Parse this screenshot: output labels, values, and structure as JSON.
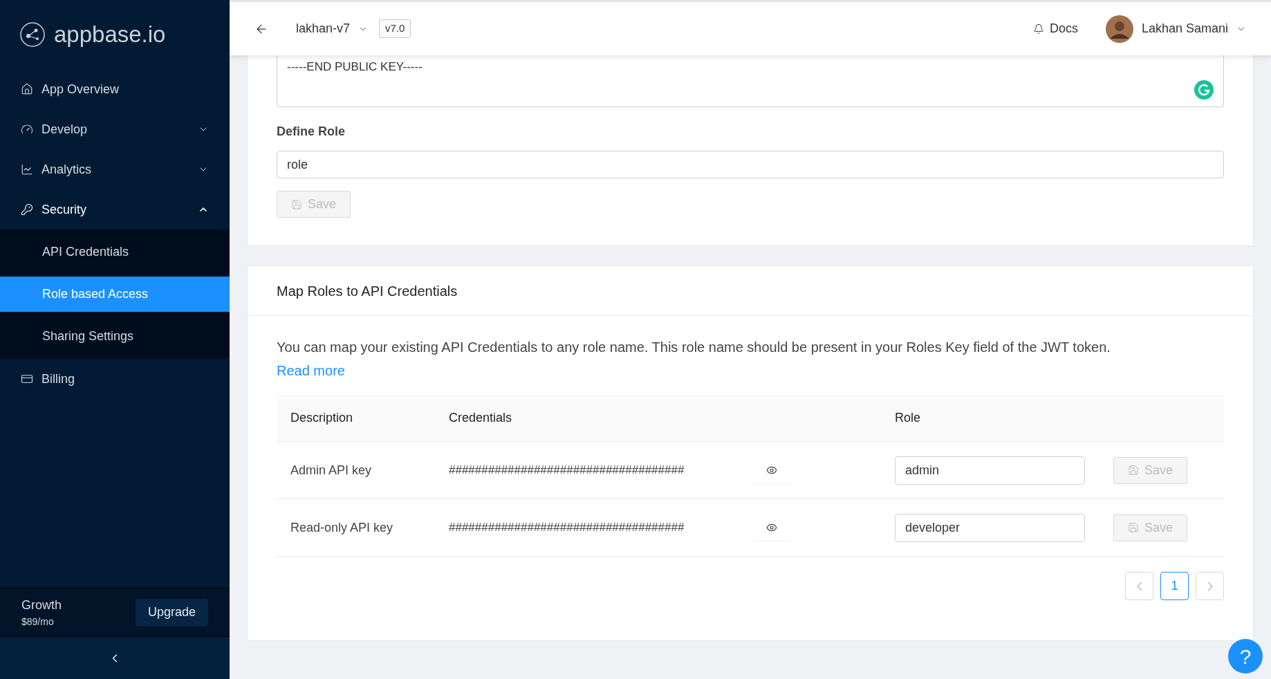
{
  "sidebar": {
    "logo": "appbase.io",
    "items": [
      {
        "label": "App Overview"
      },
      {
        "label": "Develop",
        "expanded": false
      },
      {
        "label": "Analytics",
        "expanded": false
      },
      {
        "label": "Security",
        "expanded": true,
        "children": [
          {
            "label": "API Credentials",
            "selected": false
          },
          {
            "label": "Role based Access",
            "selected": true
          },
          {
            "label": "Sharing Settings",
            "selected": false
          }
        ]
      },
      {
        "label": "Billing"
      }
    ],
    "plan": {
      "name": "Growth",
      "price": "$89/mo",
      "button": "Upgrade"
    }
  },
  "header": {
    "app": "lakhan-v7",
    "version": "v7.0",
    "docs": "Docs",
    "user": "Lakhan Samani"
  },
  "public_key": {
    "visible_text": "-----END PUBLIC KEY-----"
  },
  "define_role": {
    "label": "Define Role",
    "value": "role",
    "save": "Save",
    "save_disabled": true
  },
  "map_roles": {
    "title": "Map Roles to API Credentials",
    "description": "You can map your existing API Credentials to any role name. This role name should be present in your Roles Key field of the JWT token.",
    "link": "Read more",
    "table": {
      "columns": [
        "Description",
        "Credentials",
        "Role"
      ],
      "rows": [
        {
          "description": "Admin API key",
          "credentials": "####################################",
          "role": "admin",
          "save": "Save",
          "save_disabled": true
        },
        {
          "description": "Read-only API key",
          "credentials": "####################################",
          "role": "developer",
          "save": "Save",
          "save_disabled": true
        }
      ]
    },
    "pagination": [
      {
        "label": "1",
        "selected": true
      }
    ]
  },
  "help": "?"
}
